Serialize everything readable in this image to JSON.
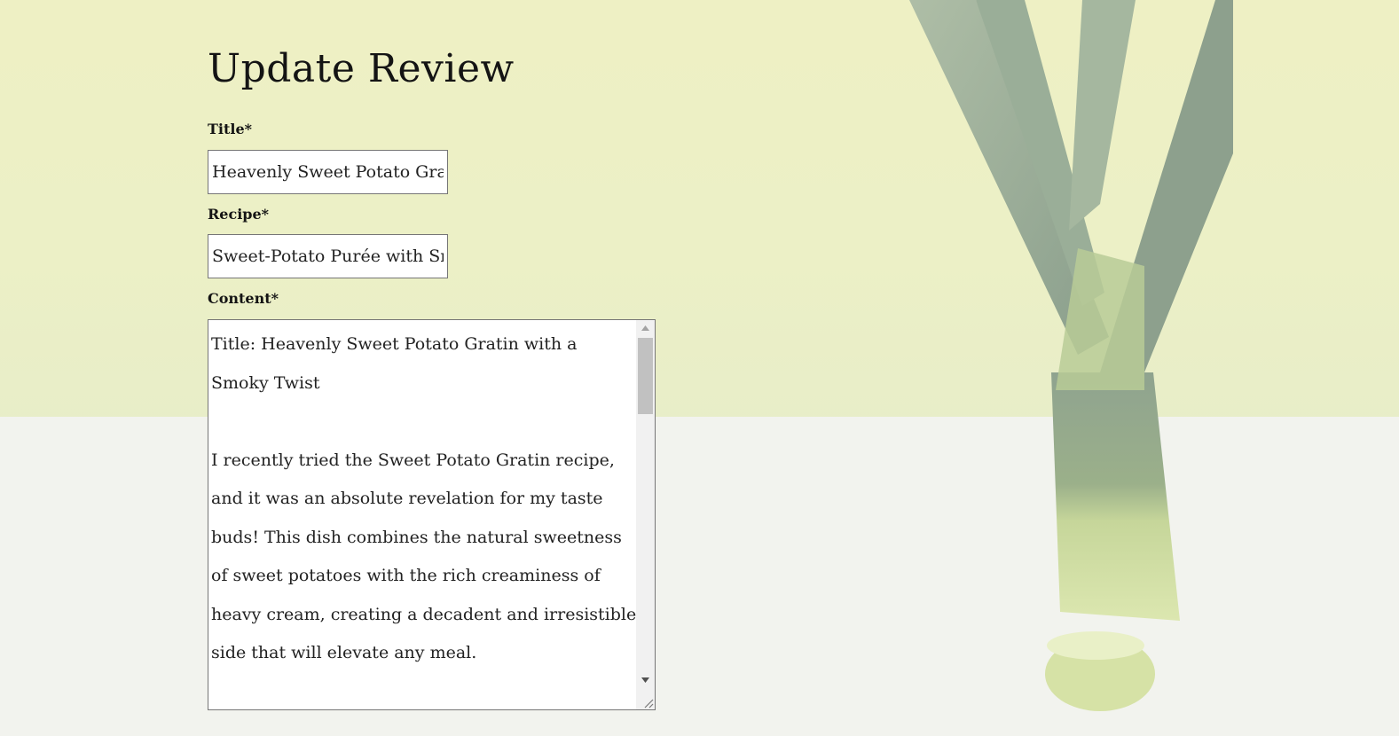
{
  "page": {
    "title": "Update Review"
  },
  "form": {
    "title_label": "Title*",
    "title_value": "Heavenly Sweet Potato Gratin with a Smoky Twist",
    "recipe_label": "Recipe*",
    "recipe_value": "Sweet-Potato Purée with Smoked Paprika",
    "content_label": "Content*",
    "content_value": "Title: Heavenly Sweet Potato Gratin with a\nSmoky Twist\n\nI recently tried the Sweet Potato Gratin recipe,\nand it was an absolute revelation for my taste\nbuds! This dish combines the natural sweetness\nof sweet potatoes with the rich creaminess of\nheavy cream, creating a decadent and irresistible\nside that will elevate any meal."
  },
  "icons": {
    "scroll_up": "triangle-up-icon",
    "scroll_down": "triangle-down-icon",
    "resize": "resize-grip-icon",
    "background": "leek-illustration"
  },
  "colors": {
    "background_top": "#eef0c4",
    "background_bottom": "#f2f3ee",
    "text": "#141414",
    "input_border": "#767676"
  }
}
